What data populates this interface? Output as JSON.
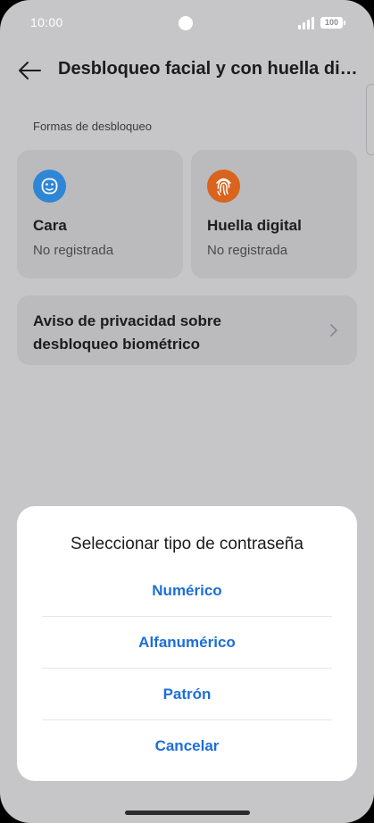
{
  "status_bar": {
    "time": "10:00",
    "battery": "100",
    "icons": [
      "camera-cutout",
      "signal-icon",
      "battery-icon"
    ]
  },
  "header": {
    "title": "Desbloqueo facial y con huella digital",
    "back_icon": "arrow-left-icon"
  },
  "section": {
    "label": "Formas de desbloqueo"
  },
  "cards": [
    {
      "icon": "face-icon",
      "icon_color": "#2f86d6",
      "title": "Cara",
      "status": "No registrada"
    },
    {
      "icon": "fingerprint-icon",
      "icon_color": "#d8641d",
      "title": "Huella digital",
      "status": "No registrada"
    }
  ],
  "privacy": {
    "text": "Aviso de privacidad sobre desbloqueo biométrico",
    "icon": "chevron-right-icon"
  },
  "dialog": {
    "title": "Seleccionar tipo de contraseña",
    "options": [
      "Numérico",
      "Alfanumérico",
      "Patrón"
    ],
    "cancel": "Cancelar",
    "accent_color": "#1d6ed8"
  },
  "colors": {
    "background_dimmed": "#c6c6c8",
    "card": "#bbbbbd",
    "dialog": "#ffffff"
  }
}
